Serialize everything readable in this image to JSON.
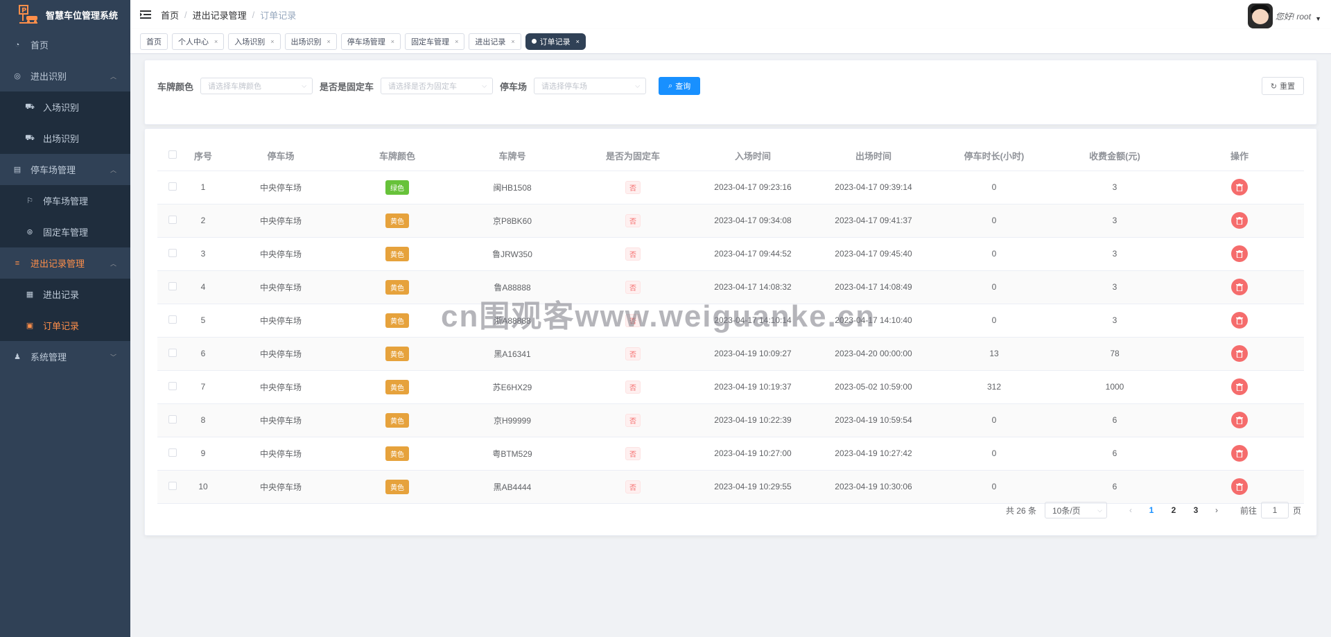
{
  "app": {
    "title": "智慧车位管理系统"
  },
  "sidebar": {
    "items": [
      {
        "label": "首页",
        "level": 0,
        "icon": "dashboard-icon"
      },
      {
        "label": "进出识别",
        "level": 0,
        "icon": "radar-icon",
        "expanded": true
      },
      {
        "label": "入场识别",
        "level": 1,
        "icon": "car-icon"
      },
      {
        "label": "出场识别",
        "level": 1,
        "icon": "car-icon"
      },
      {
        "label": "停车场管理",
        "level": 0,
        "icon": "document-icon",
        "expanded": true
      },
      {
        "label": "停车场管理",
        "level": 1,
        "icon": "parking-icon"
      },
      {
        "label": "固定车管理",
        "level": 1,
        "icon": "steering-icon"
      },
      {
        "label": "进出记录管理",
        "level": 0,
        "icon": "list-icon",
        "expanded": true,
        "active": true
      },
      {
        "label": "进出记录",
        "level": 1,
        "icon": "record-icon"
      },
      {
        "label": "订单记录",
        "level": 1,
        "icon": "order-icon",
        "active": true
      },
      {
        "label": "系统管理",
        "level": 0,
        "icon": "user-icon",
        "expanded": false
      }
    ]
  },
  "header": {
    "breadcrumb": [
      "首页",
      "进出记录管理",
      "订单记录"
    ],
    "greeting": "您好! root"
  },
  "tags": [
    "首页",
    "个人中心",
    "入场识别",
    "出场识别",
    "停车场管理",
    "固定车管理",
    "进出记录",
    "订单记录"
  ],
  "search": {
    "plate_color_label": "车牌颜色",
    "plate_color_placeholder": "请选择车牌颜色",
    "fixed_label": "是否是固定车",
    "fixed_placeholder": "请选择是否为固定车",
    "lot_label": "停车场",
    "lot_placeholder": "请选择停车场",
    "query_label": "查询",
    "reset_label": "重置"
  },
  "table": {
    "columns": [
      "序号",
      "停车场",
      "车牌颜色",
      "车牌号",
      "是否为固定车",
      "入场时间",
      "出场时间",
      "停车时长(小时)",
      "收费金额(元)",
      "操作"
    ],
    "rows": [
      {
        "no": "1",
        "lot": "中央停车场",
        "color": "绿色",
        "color_type": "green",
        "plate": "闽HB1508",
        "fixed": "否",
        "in": "2023-04-17 09:23:16",
        "out": "2023-04-17 09:39:14",
        "hours": "0",
        "fee": "3"
      },
      {
        "no": "2",
        "lot": "中央停车场",
        "color": "黄色",
        "color_type": "yellow",
        "plate": "京P8BK60",
        "fixed": "否",
        "in": "2023-04-17 09:34:08",
        "out": "2023-04-17 09:41:37",
        "hours": "0",
        "fee": "3"
      },
      {
        "no": "3",
        "lot": "中央停车场",
        "color": "黄色",
        "color_type": "yellow",
        "plate": "鲁JRW350",
        "fixed": "否",
        "in": "2023-04-17 09:44:52",
        "out": "2023-04-17 09:45:40",
        "hours": "0",
        "fee": "3"
      },
      {
        "no": "4",
        "lot": "中央停车场",
        "color": "黄色",
        "color_type": "yellow",
        "plate": "鲁A88888",
        "fixed": "否",
        "in": "2023-04-17 14:08:32",
        "out": "2023-04-17 14:08:49",
        "hours": "0",
        "fee": "3"
      },
      {
        "no": "5",
        "lot": "中央停车场",
        "color": "黄色",
        "color_type": "yellow",
        "plate": "浙A88888",
        "fixed": "否",
        "in": "2023-04-17 14:10:14",
        "out": "2023-04-17 14:10:40",
        "hours": "0",
        "fee": "3"
      },
      {
        "no": "6",
        "lot": "中央停车场",
        "color": "黄色",
        "color_type": "yellow",
        "plate": "黑A16341",
        "fixed": "否",
        "in": "2023-04-19 10:09:27",
        "out": "2023-04-20 00:00:00",
        "hours": "13",
        "fee": "78"
      },
      {
        "no": "7",
        "lot": "中央停车场",
        "color": "黄色",
        "color_type": "yellow",
        "plate": "苏E6HX29",
        "fixed": "否",
        "in": "2023-04-19 10:19:37",
        "out": "2023-05-02 10:59:00",
        "hours": "312",
        "fee": "1000"
      },
      {
        "no": "8",
        "lot": "中央停车场",
        "color": "黄色",
        "color_type": "yellow",
        "plate": "京H99999",
        "fixed": "否",
        "in": "2023-04-19 10:22:39",
        "out": "2023-04-19 10:59:54",
        "hours": "0",
        "fee": "6"
      },
      {
        "no": "9",
        "lot": "中央停车场",
        "color": "黄色",
        "color_type": "yellow",
        "plate": "粤BTM529",
        "fixed": "否",
        "in": "2023-04-19 10:27:00",
        "out": "2023-04-19 10:27:42",
        "hours": "0",
        "fee": "6"
      },
      {
        "no": "10",
        "lot": "中央停车场",
        "color": "黄色",
        "color_type": "yellow",
        "plate": "黑AB4444",
        "fixed": "否",
        "in": "2023-04-19 10:29:55",
        "out": "2023-04-19 10:30:06",
        "hours": "0",
        "fee": "6"
      }
    ]
  },
  "pagination": {
    "total": "共 26 条",
    "page_size": "10条/页",
    "pages": [
      "1",
      "2",
      "3"
    ],
    "current": "1",
    "goto_prefix": "前往",
    "goto_value": "1",
    "goto_suffix": "页"
  },
  "watermark": "cn围观客www.weiguanke.cn",
  "colors": {
    "sidebar_bg": "#304156",
    "accent": "#ff8f4a",
    "primary": "#1890ff",
    "danger": "#f56c6c",
    "success": "#67c23a",
    "warning": "#e6a23c"
  }
}
